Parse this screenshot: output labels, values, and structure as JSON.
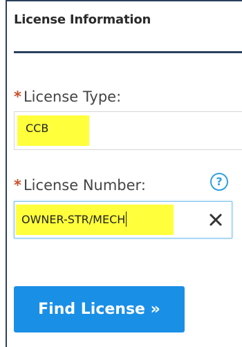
{
  "section": {
    "title": "License Information"
  },
  "form": {
    "required_mark": "*",
    "license_type": {
      "label": "License Type:",
      "value": "CCB"
    },
    "license_number": {
      "label": "License Number:",
      "value": "OWNER-STR/MECH",
      "help_icon": "question-circle-icon",
      "help_glyph": "?",
      "clear_icon": "close-x-icon"
    },
    "find_button_label": "Find License »"
  },
  "colors": {
    "accent": "#1a8fe6",
    "border_dark": "#2a3f5c",
    "required": "#c8502a",
    "highlight": "#ffff3b",
    "help": "#2ea0e0"
  }
}
